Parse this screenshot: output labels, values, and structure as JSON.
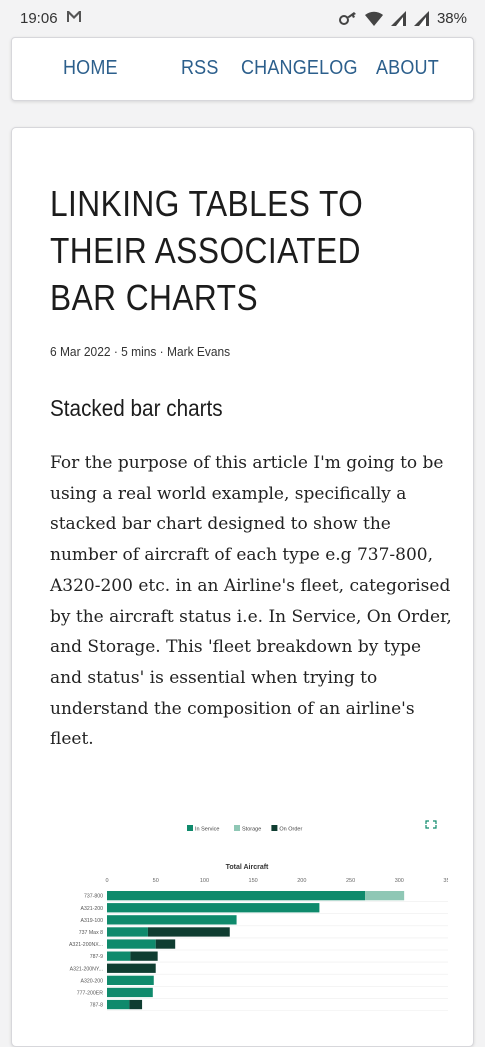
{
  "status_bar": {
    "time": "19:06",
    "battery": "38%",
    "icons": [
      "gmail-icon",
      "key-icon",
      "wifi-icon",
      "signal-icon",
      "signal-icon",
      "battery-icon"
    ]
  },
  "nav": {
    "home": "HOME",
    "rss": "RSS",
    "changelog": "CHANGELOG",
    "about": "ABOUT"
  },
  "article": {
    "title": "LINKING TABLES TO THEIR ASSOCIATED BAR CHARTS",
    "meta": "6 Mar 2022 · 5 mins · Mark Evans",
    "subheading": "Stacked bar charts",
    "paragraph": "For the purpose of this article I'm going to be using a real world example, specifically a stacked bar chart designed to show the number of aircraft of each type e.g 737-800, A320-200 etc. in an Airline's fleet, categorised by the aircraft status i.e. In Service, On Order, and Storage. This 'fleet breakdown by type and status' is essential when trying to understand the composition of an airline's fleet."
  },
  "chart_data": {
    "type": "bar",
    "orientation": "horizontal",
    "stacked": true,
    "title": "Total Aircraft",
    "legend_position": "top",
    "xlim": [
      0,
      350
    ],
    "x_ticks": [
      0,
      50,
      100,
      150,
      200,
      250,
      300,
      350
    ],
    "categories": [
      "737-800",
      "A321-200",
      "A319-100",
      "737 Max 8",
      "A321-200NX...",
      "787-9",
      "A321-200NY...",
      "A320-200",
      "777-200ER",
      "787-8"
    ],
    "series": [
      {
        "name": "In Service",
        "color": "#0f8a6c",
        "values": [
          265,
          218,
          133,
          42,
          50,
          24,
          0,
          48,
          47,
          23
        ]
      },
      {
        "name": "Storage",
        "color": "#8fc7b5",
        "values": [
          40,
          0,
          0,
          0,
          0,
          0,
          0,
          0,
          0,
          0
        ]
      },
      {
        "name": "On Order",
        "color": "#0f3d31",
        "values": [
          0,
          0,
          0,
          84,
          20,
          28,
          50,
          0,
          0,
          13
        ]
      }
    ]
  }
}
